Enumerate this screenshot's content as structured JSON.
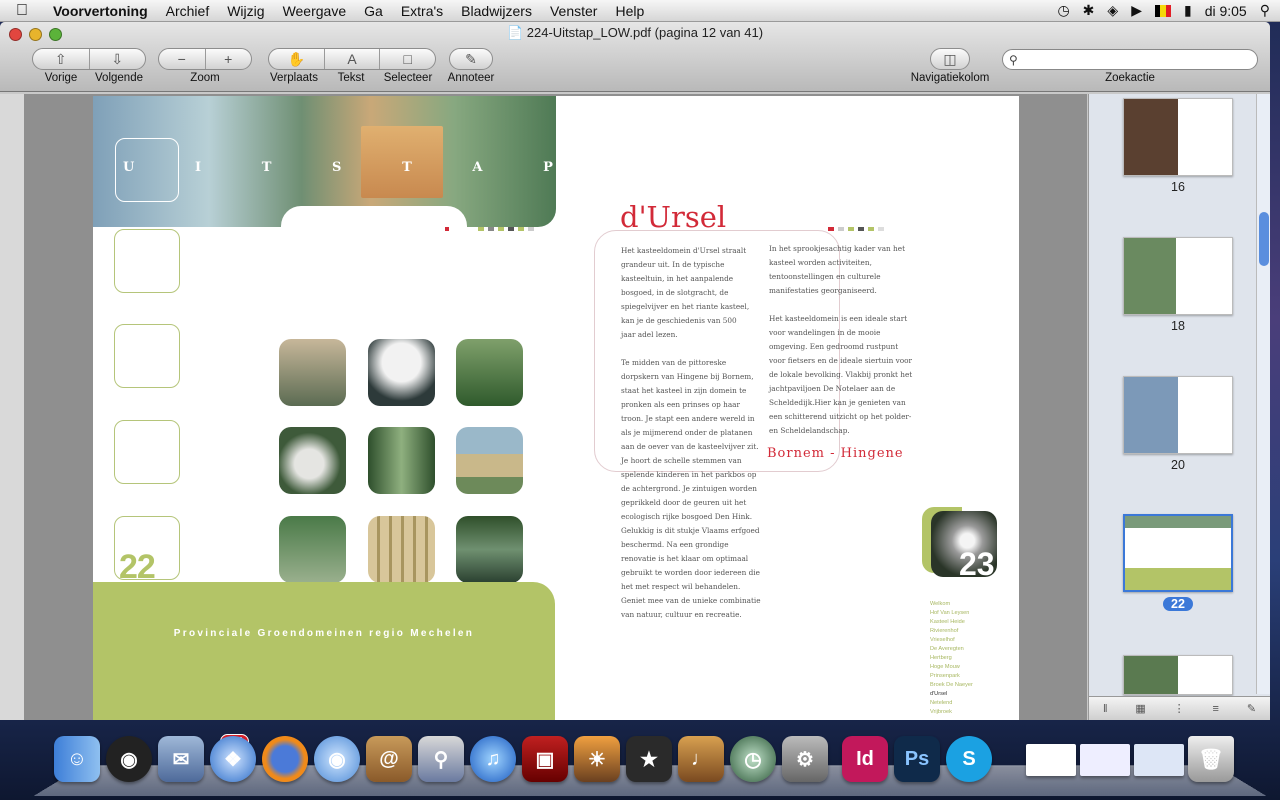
{
  "menubar": {
    "apple": "",
    "app": "Voorvertoning",
    "items": [
      "Archief",
      "Wijzig",
      "Weergave",
      "Ga",
      "Extra's",
      "Bladwijzers",
      "Venster",
      "Help"
    ],
    "clock": "di 9:05"
  },
  "window": {
    "title": "224-Uitstap_LOW.pdf (pagina 12 van 41)"
  },
  "toolbar": {
    "prev": "Vorige",
    "next": "Volgende",
    "zoom": "Zoom",
    "move": "Verplaats",
    "text": "Tekst",
    "select": "Selecteer",
    "annotate": "Annoteer",
    "nav": "Navigatiekolom",
    "search_label": "Zoekactie",
    "search_value": ""
  },
  "page_left": {
    "banner_letters": [
      "U",
      "I",
      "T",
      "S",
      "T",
      "A",
      "P"
    ],
    "page_number": "22",
    "footer": "Provinciale Groendomeinen regio Mechelen"
  },
  "page_right": {
    "heading": "d'Ursel",
    "col1": [
      "Het kasteeldomein d'Ursel straalt",
      "grandeur uit. In de typische",
      "kasteeltuin, in het aanpalende",
      "bosgoed, in de slotgracht, de",
      "spiegelvijver en het riante kasteel,",
      "kan je de geschiedenis van 500",
      "jaar adel lezen.",
      "",
      "Te midden van de pittoreske",
      "dorpskern van Hingene bij Bornem,",
      "staat het kasteel in zijn domein te",
      "pronken als een prinses op haar",
      "troon. Je stapt een andere wereld in",
      "als je mijmerend onder de platanen",
      "aan de oever van de kasteelvijver zit.",
      "Je hoort de schelle stemmen van",
      "spelende kinderen in het parkbos op",
      "de achtergrond. Je zintuigen worden",
      "geprikkeld door de geuren uit het",
      "ecologisch rijke bosgoed Den Hink.",
      "Gelukkig is dit stukje Vlaams erfgoed",
      "beschermd. Na een grondige",
      "renovatie is het klaar om optimaal",
      "gebruikt te worden door iedereen die",
      "het met respect wil behandelen.",
      "Geniet mee van de unieke combinatie",
      "van natuur, cultuur en recreatie."
    ],
    "col2": [
      "In het  sprookjesachtig kader van het",
      "kasteel worden activiteiten,",
      "tentoonstellingen en culturele",
      "manifestaties georganiseerd.",
      "",
      "Het kasteeldomein is een ideale start",
      "voor wandelingen in de mooie",
      "omgeving. Een gedroomd rustpunt",
      "voor fietsers en de ideale siertuin voor",
      "de lokale bevolking. Vlakbij pronkt het",
      "jachtpaviljoen De Notelaer aan de",
      "Scheldedijk.Hier kan je genieten van",
      "een schitterend uitzicht op het polder-",
      "en Scheldelandschap."
    ],
    "subtitle": "Bornem - Hingene",
    "page_number": "23",
    "nav_list": [
      "Welkom",
      "Hof Van Leysen",
      "Kasteel Heide",
      "Rivierenhof",
      "Vrieselhof",
      "De Averegten",
      "Hertberg",
      "Hoge Mouw",
      "Prinsenpark",
      "Broek De Naeyer",
      "d'Ursel",
      "Netelend",
      "Vrijbroek"
    ],
    "nav_current": "d'Ursel"
  },
  "sidebar": {
    "thumbs": [
      "16",
      "18",
      "20",
      "22"
    ],
    "selected": "22"
  },
  "dock": {
    "mail_badge": "404",
    "apps": [
      "Finder",
      "Dashboard",
      "Mail",
      "Safari",
      "Firefox",
      "iChat",
      "Adresboek",
      "Voorvertoning",
      "iTunes",
      "Photo Booth",
      "iPhoto",
      "iMovie",
      "GarageBand",
      "Time Machine",
      "Systeemvoorkeuren",
      "InDesign",
      "Photoshop",
      "Skype"
    ]
  }
}
